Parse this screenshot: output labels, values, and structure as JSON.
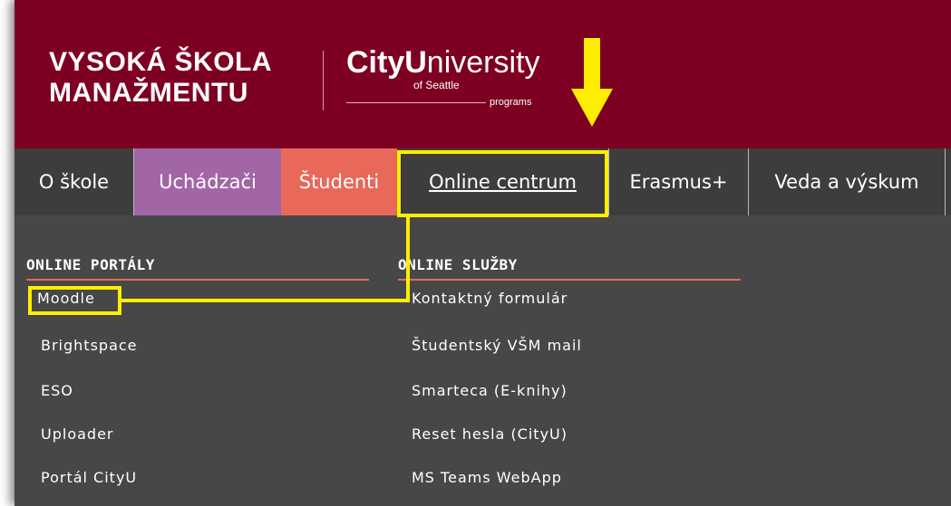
{
  "brand": {
    "school_line1": "VYSOKÁ ŠKOLA",
    "school_line2": "MANAŽMENTU",
    "cityu_bold": "City",
    "cityu_u": "U",
    "cityu_rest": "niversity",
    "cityu_sub": "of Seattle",
    "cityu_programs": "programs"
  },
  "nav": {
    "items": [
      {
        "label": "O škole",
        "color": "#3d3d3d"
      },
      {
        "label": "Uchádzači",
        "color": "#a265a6"
      },
      {
        "label": "Študenti",
        "color": "#e8685a"
      },
      {
        "label": "Online centrum",
        "color": "#3d3d3d"
      },
      {
        "label": "Erasmus+",
        "color": "#3d3d3d"
      },
      {
        "label": "Veda a výskum",
        "color": "#3d3d3d"
      }
    ],
    "active": "Online centrum"
  },
  "dropdown": {
    "portals": {
      "heading": "ONLINE PORTÁLY",
      "links": [
        "Moodle",
        "Brightspace",
        "ESO",
        "Uploader",
        "Portál CityU"
      ]
    },
    "services": {
      "heading": "ONLINE SLUŽBY",
      "links": [
        "Kontaktný formulár",
        "Študentský VŠM mail",
        "Smarteca (E-knihy)",
        "Reset hesla (CityU)",
        "MS Teams WebApp"
      ]
    }
  },
  "colors": {
    "header_bg": "#7d0023",
    "nav_bg": "#3d3d3d",
    "dropdown_bg": "#474747",
    "highlight": "#ffee00",
    "rule": "#e06a59"
  }
}
